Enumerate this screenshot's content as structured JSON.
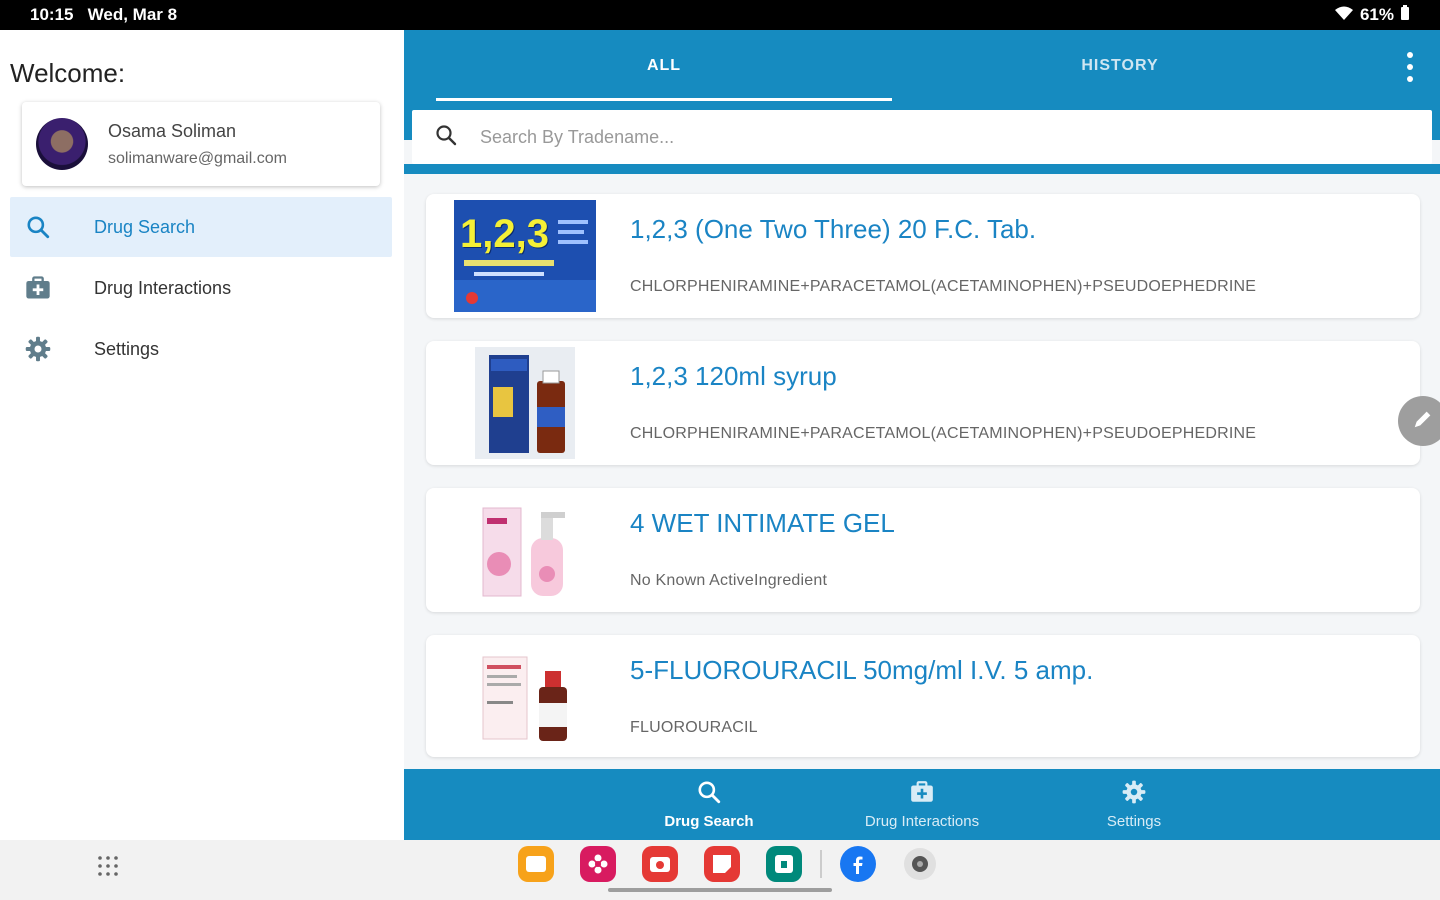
{
  "status_bar": {
    "time": "10:15",
    "date": "Wed, Mar 8",
    "battery": "61%"
  },
  "drawer": {
    "welcome": "Welcome:",
    "user": {
      "name": "Osama Soliman",
      "email": "solimanware@gmail.com"
    },
    "items": [
      {
        "label": "Drug Search",
        "icon": "search-icon",
        "active": true
      },
      {
        "label": "Drug Interactions",
        "icon": "medkit-icon",
        "active": false
      },
      {
        "label": "Settings",
        "icon": "gear-icon",
        "active": false
      }
    ]
  },
  "tabs": [
    {
      "label": "ALL",
      "active": true
    },
    {
      "label": "HISTORY",
      "active": false
    }
  ],
  "search": {
    "placeholder": "Search By Tradename..."
  },
  "drugs": [
    {
      "name": "1,2,3 (One Two Three) 20 F.C. Tab.",
      "ingredients": "CHLORPHENIRAMINE+PARACETAMOL(ACETAMINOPHEN)+PSEUDOEPHEDRINE",
      "thumb_text": "1,2,3"
    },
    {
      "name": "1,2,3 120ml syrup",
      "ingredients": "CHLORPHENIRAMINE+PARACETAMOL(ACETAMINOPHEN)+PSEUDOEPHEDRINE"
    },
    {
      "name": "4 WET INTIMATE GEL",
      "ingredients": "No Known ActiveIngredient"
    },
    {
      "name": "5-FLUOROURACIL 50mg/ml I.V. 5 amp.",
      "ingredients": "FLUOROURACIL"
    }
  ],
  "bottom_nav": [
    {
      "label": "Drug Search",
      "icon": "search-icon",
      "active": true
    },
    {
      "label": "Drug Interactions",
      "icon": "medkit-icon",
      "active": false
    },
    {
      "label": "Settings",
      "icon": "gear-icon",
      "active": false
    }
  ],
  "colors": {
    "primary": "#168bc0",
    "accent_text": "#1a84c4",
    "active_nav_bg": "#e3effb"
  }
}
